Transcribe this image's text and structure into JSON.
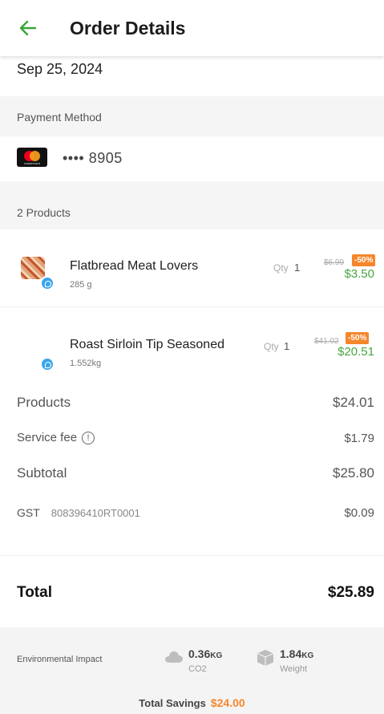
{
  "header": {
    "title": "Order Details",
    "back_icon": "arrow-left-icon",
    "accent": "#3aa53a"
  },
  "order": {
    "date": "Sep 25, 2024"
  },
  "payment": {
    "section_label": "Payment Method",
    "card_brand": "mastercard",
    "card_brand_text": "mastercard",
    "card_number": "•••• 8905"
  },
  "products_section": {
    "label": "2 Products"
  },
  "products": [
    {
      "name": "Flatbread Meat Lovers",
      "weight": "285 g",
      "qty_label": "Qty",
      "qty": "1",
      "old_price": "$6.99",
      "discount": "-50%",
      "price": "$3.50"
    },
    {
      "name": "Roast Sirloin Tip Seasoned",
      "weight": "1.552kg",
      "qty_label": "Qty",
      "qty": "1",
      "old_price": "$41.02",
      "discount": "-50%",
      "price": "$20.51"
    }
  ],
  "summary": {
    "products_label": "Products",
    "products_value": "$24.01",
    "service_fee_label": "Service fee",
    "service_fee_value": "$1.79",
    "subtotal_label": "Subtotal",
    "subtotal_value": "$25.80",
    "gst_label": "GST",
    "gst_number": "808396410RT0001",
    "gst_value": "$0.09"
  },
  "total": {
    "label": "Total",
    "value": "$25.89"
  },
  "environment": {
    "label": "Environmental Impact",
    "co2_value": "0.36",
    "co2_unit": "KG",
    "co2_label": "CO2",
    "weight_value": "1.84",
    "weight_unit": "KG",
    "weight_label": "Weight",
    "savings_label": "Total Savings",
    "savings_value": "$24.00"
  },
  "colors": {
    "discount": "#f5862a",
    "price_green": "#46a63f",
    "badge_blue": "#3aa5ea"
  }
}
